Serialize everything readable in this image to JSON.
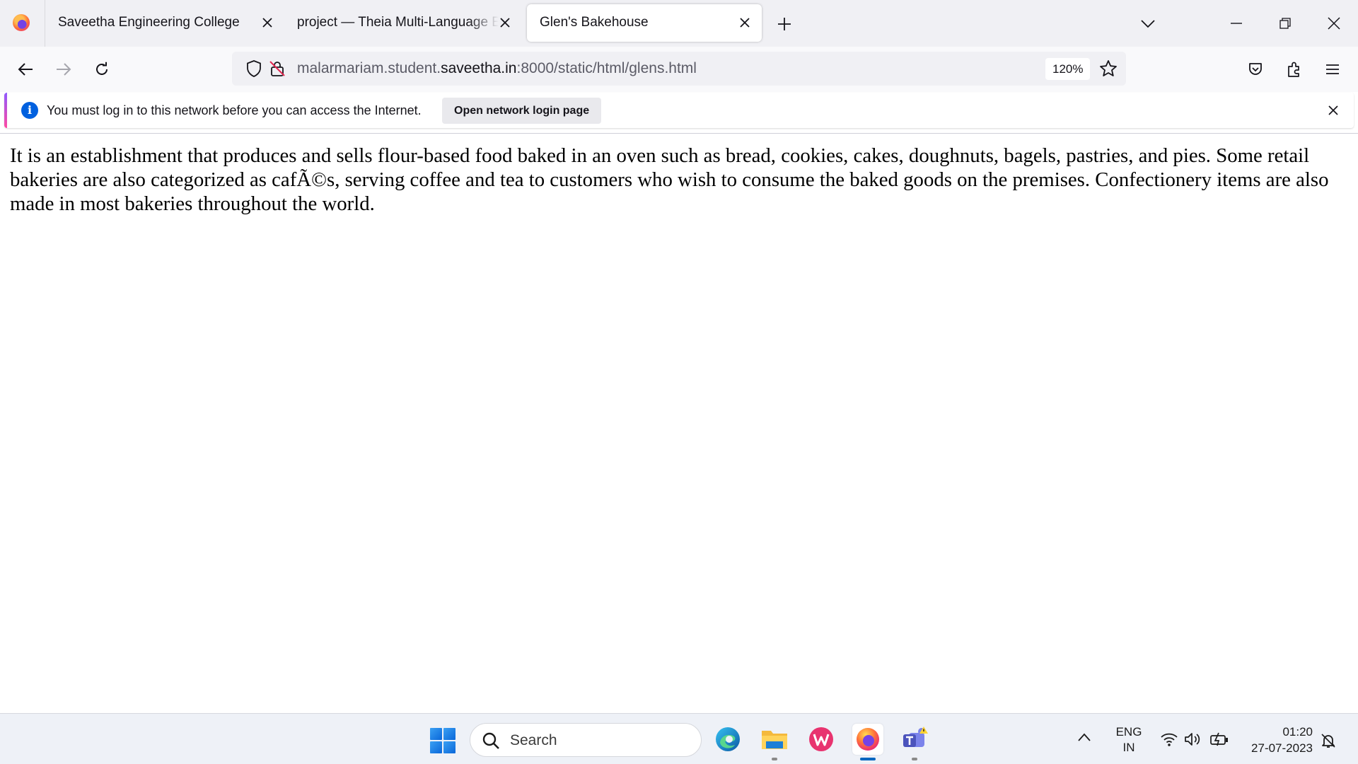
{
  "browser": {
    "tabs": [
      {
        "label": "Saveetha Engineering College",
        "active": false
      },
      {
        "label": "project — Theia Multi-Language Example",
        "active": false
      },
      {
        "label": "Glen's Bakehouse",
        "active": true
      }
    ],
    "url": {
      "prefix": "malarmariam.student.",
      "host": "saveetha.in",
      "suffix": ":8000/static/html/glens.html"
    },
    "zoom": "120%",
    "accent_color": "#0060df"
  },
  "notification": {
    "message": "You must log in to this network before you can access the Internet.",
    "button_label": "Open network login page"
  },
  "page": {
    "paragraph": "It is an establishment that produces and sells flour-based food baked in an oven such as bread, cookies, cakes, doughnuts, bagels, pastries, and pies. Some retail bakeries are also categorized as cafÃ©s, serving coffee and tea to customers who wish to consume the baked goods on the premises. Confectionery items are also made in most bakeries throughout the world."
  },
  "taskbar": {
    "search_placeholder": "Search",
    "apps": [
      "edge-icon",
      "file-explorer-icon",
      "wps-office-icon",
      "firefox-icon",
      "teams-icon"
    ],
    "language": {
      "line1": "ENG",
      "line2": "IN"
    },
    "time": "01:20",
    "date": "27-07-2023"
  }
}
